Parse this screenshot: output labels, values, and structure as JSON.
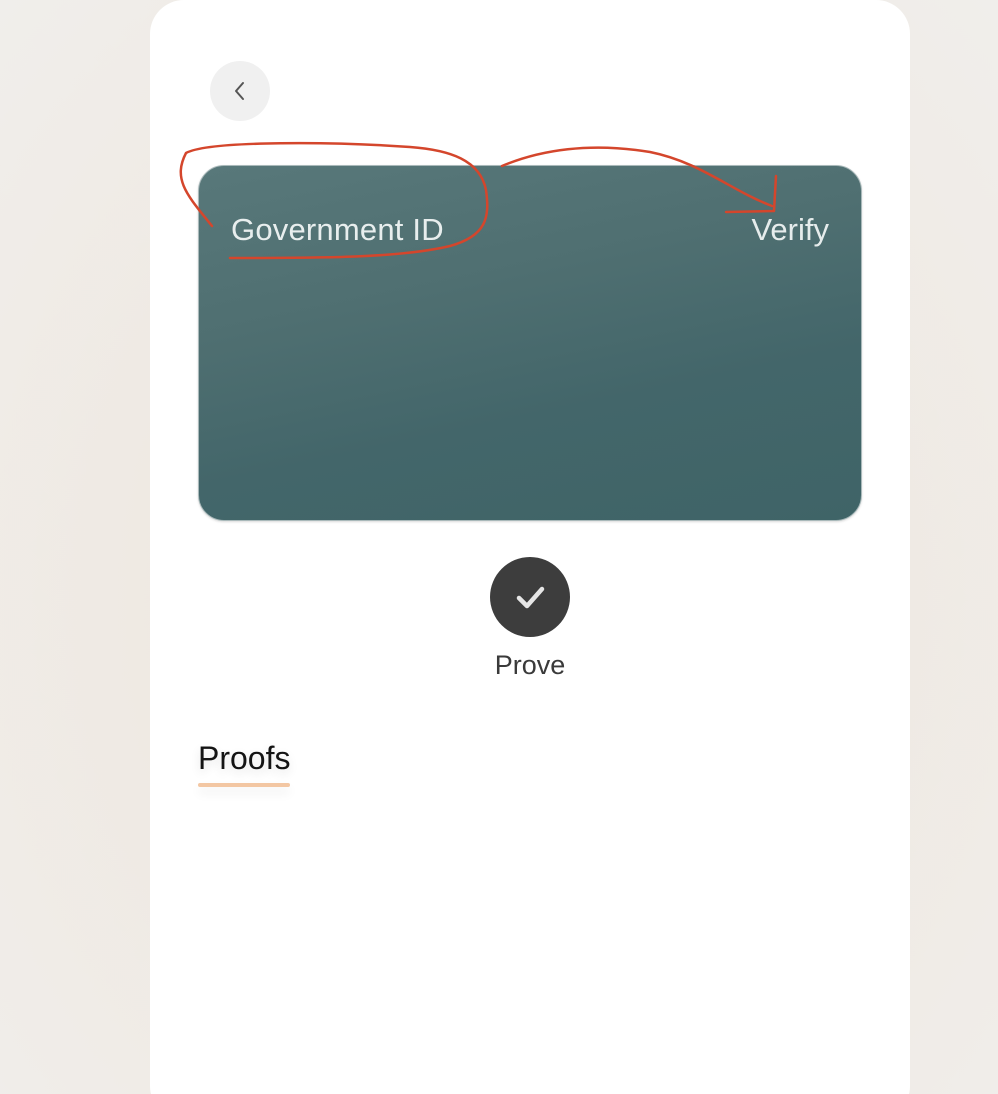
{
  "navigation": {
    "back_icon": "chevron-left-icon"
  },
  "card": {
    "title": "Government ID",
    "verify_label": "Verify",
    "colors": {
      "top": "#58787a",
      "bottom": "#3f6467"
    }
  },
  "prove": {
    "icon": "checkmark-icon",
    "label": "Prove"
  },
  "proofs": {
    "heading": "Proofs",
    "underline_color": "#f3c7a3"
  },
  "annotation": {
    "color": "#d4462c"
  }
}
